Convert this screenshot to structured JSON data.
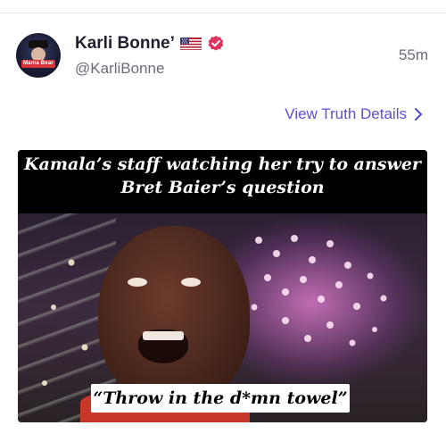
{
  "post": {
    "author_name": "Karli Bonne’",
    "handle": "@KarliBonne",
    "timestamp": "55m",
    "view_details_label": "View Truth Details",
    "avatar_text": "Mama Bear"
  },
  "icons": {
    "flag": "us-flag-icon",
    "verified": "verified-badge-icon",
    "chevron": "chevron-right-icon"
  },
  "media": {
    "caption_top": "Kamala’s staff watching her try to answer Bret Baier’s question",
    "caption_bottom": "“Throw in the d*mn towel”"
  },
  "colors": {
    "accent": "#5b50d8",
    "verified": "#e0325f",
    "text_primary": "#1f1f2e",
    "text_secondary": "#6b6b7b"
  }
}
